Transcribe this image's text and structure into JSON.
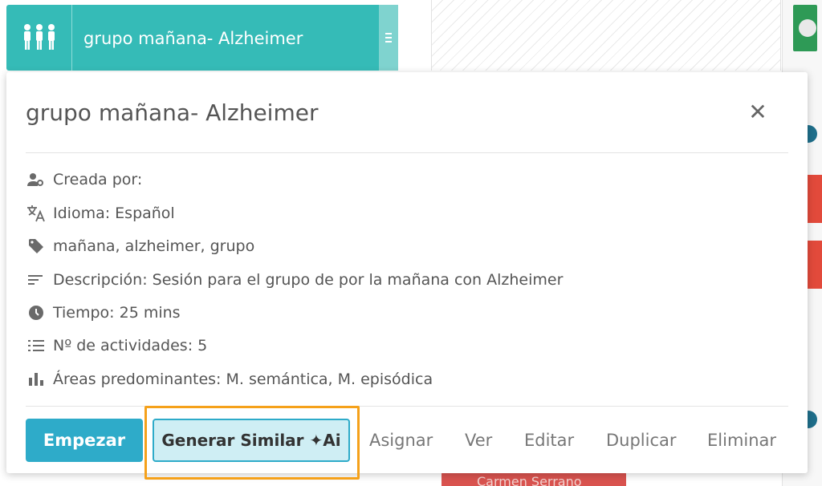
{
  "background_card": {
    "title": "grupo mañana- Alzheimer",
    "icon": "group-icon",
    "menu_icon": "kebab-menu-icon",
    "color": "#35bbb7"
  },
  "popup": {
    "title": "grupo mañana- Alzheimer",
    "close_glyph": "✕",
    "info": {
      "created_by": "Creada por:",
      "language": "Idioma: Español",
      "tags": "mañana, alzheimer, grupo",
      "description": "Descripción: Sesión para el grupo de por la mañana con Alzheimer",
      "time": "Tiempo: 25 mins",
      "activities": "Nº de actividades: 5",
      "areas": "Áreas predominantes: M. semántica, M. episódica"
    },
    "actions": {
      "start": "Empezar",
      "generate_similar": "Generar Similar ✦Ai",
      "assign": "Asignar",
      "view": "Ver",
      "edit": "Editar",
      "duplicate": "Duplicar",
      "delete": "Eliminar"
    }
  },
  "peek": {
    "bottom_name": "Carmen Serrano"
  },
  "colors": {
    "accent": "#2eabc9",
    "highlight": "#f5a11a",
    "text": "#555555"
  }
}
